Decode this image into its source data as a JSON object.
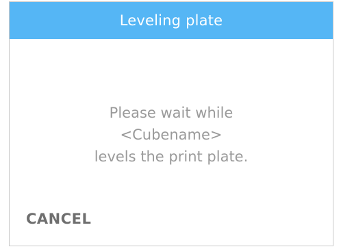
{
  "dialog": {
    "title": "Leveling plate",
    "message_lines": [
      "Please wait while",
      "<Cubename>",
      "levels the print plate."
    ],
    "cancel_label": "CANCEL"
  },
  "colors": {
    "header_background": "#55b6f5",
    "header_text": "#ffffff",
    "message_text": "#9a9a9a",
    "cancel_text": "#6f6f6f"
  }
}
